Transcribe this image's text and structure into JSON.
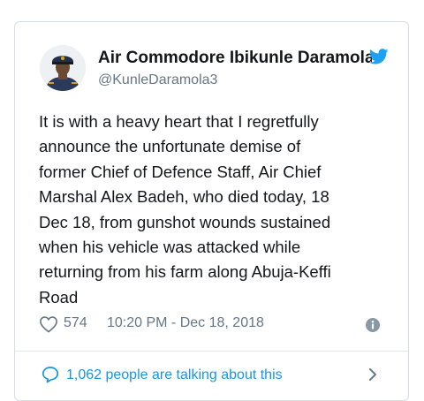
{
  "author": {
    "display_name": "Air Commodore Ibikunle Daramola",
    "handle": "@KunleDaramola3"
  },
  "tweet": {
    "lines": [
      "It is with a heavy heart that I regretfully",
      "announce the unfortunate demise of",
      "former Chief of Defence Staff, Air Chief",
      "Marshal Alex Badeh, who died today, 18",
      "Dec 18, from gunshot wounds sustained",
      "when his vehicle was attacked while",
      "returning from his farm along Abuja-Keffi",
      "Road"
    ],
    "like_count": "574",
    "timestamp": "10:20 PM - Dec 18, 2018"
  },
  "conversation": {
    "label": "1,062 people are talking about this"
  },
  "icons": {
    "brand": "twitter-bird-icon",
    "like": "heart-icon",
    "info": "info-icon",
    "reply": "speech-bubble-icon",
    "more": "chevron-right-icon"
  },
  "colors": {
    "brand_blue": "#1da1f2",
    "link_blue": "#1b95e0",
    "text": "#14171a",
    "secondary_text": "#657786",
    "border": "#d6dde3"
  }
}
